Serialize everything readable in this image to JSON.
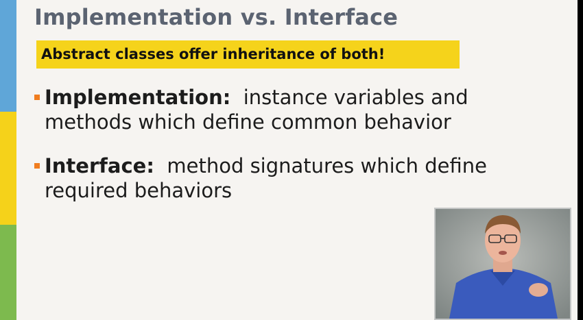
{
  "slide": {
    "title": "Implementation vs. Interface",
    "highlight": "Abstract classes offer inheritance of both!",
    "bullets": [
      {
        "term": "Implementation:",
        "line1_rest": "  instance variables and",
        "line2": "methods which define common behavior"
      },
      {
        "term": "Interface:",
        "line1_rest": "  method signatures which define",
        "line2": "required behaviors"
      }
    ]
  },
  "colors": {
    "stripe_blue": "#5fa6d8",
    "stripe_yellow": "#f5d21a",
    "stripe_green": "#7dba4e",
    "highlight": "#f5d31b",
    "bullet_marker": "#f07d1f",
    "title": "#5b6371"
  },
  "presenter_video": {
    "icon": "presenter-video-icon"
  }
}
